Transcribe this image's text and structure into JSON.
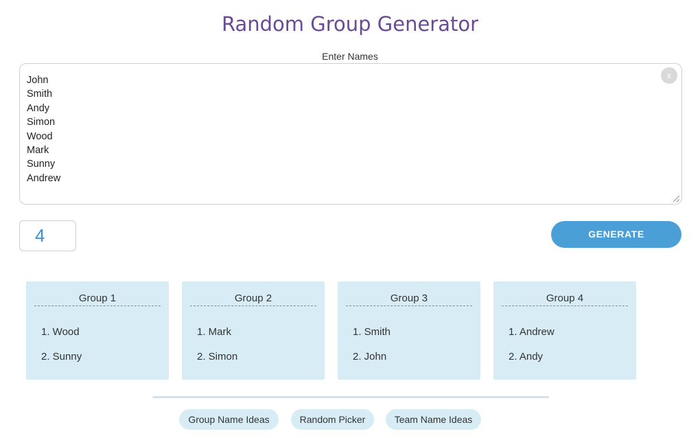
{
  "header": {
    "title": "Random Group Generator"
  },
  "names_input": {
    "label": "Enter Names",
    "clear_label": "x",
    "names": [
      "John",
      "Smith",
      "Andy",
      "Simon",
      "Wood",
      "Mark",
      "Sunny",
      "Andrew"
    ]
  },
  "group_count": {
    "value": "4"
  },
  "generate_button": {
    "label": "GENERATE"
  },
  "groups": [
    {
      "title": "Group 1",
      "members": [
        "1. Wood",
        "2. Sunny"
      ]
    },
    {
      "title": "Group 2",
      "members": [
        "1. Mark",
        "2. Simon"
      ]
    },
    {
      "title": "Group 3",
      "members": [
        "1. Smith",
        "2. John"
      ]
    },
    {
      "title": "Group 4",
      "members": [
        "1. Andrew",
        "2. Andy"
      ]
    }
  ],
  "footer_links": [
    "Group Name Ideas",
    "Random Picker",
    "Team Name Ideas"
  ],
  "colors": {
    "title": "#6a4a97",
    "accent": "#4a9fd6",
    "card_background": "#d7ecf4"
  }
}
